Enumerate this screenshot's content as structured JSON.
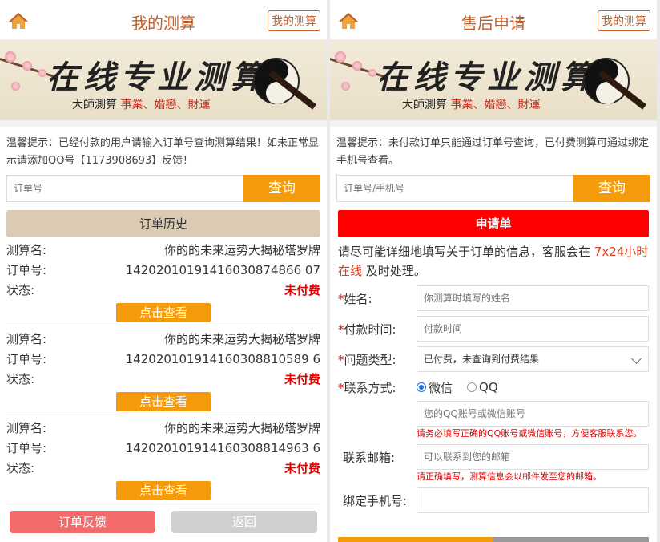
{
  "colors": {
    "accent": "#f59a0a",
    "title": "#c0612c",
    "red": "#e60000",
    "history_bar": "#dccbb4",
    "apply_bar": "#ff0000"
  },
  "banner": {
    "headline": "在线专业测算",
    "sub_prefix": "大師測算",
    "sub_items": "事業、婚戀、財運"
  },
  "left": {
    "title": "我的测算",
    "right_button": "我的测算",
    "home_icon": "home-icon",
    "tip": "温馨提示：已经付款的用户请输入订单号查询测算结果！如未正常显示请添加QQ号【1173908693】反馈！",
    "search_placeholder": "订单号",
    "search_button": "查询",
    "history_label": "订单历史",
    "field_labels": {
      "name": "测算名:",
      "order": "订单号:",
      "status": "状态:"
    },
    "view_button": "点击查看",
    "orders": [
      {
        "name": "你的的未来运势大揭秘塔罗牌",
        "order_no": "14202010191416030874866 07",
        "status": "未付费"
      },
      {
        "name": "你的的未来运势大揭秘塔罗牌",
        "order_no": "142020101914160308810589 6",
        "status": "未付费"
      },
      {
        "name": "你的的未来运势大揭秘塔罗牌",
        "order_no": "142020101914160308814963 6",
        "status": "未付费"
      }
    ],
    "bottom_buttons": [
      "订单反馈",
      "返回"
    ]
  },
  "right": {
    "title": "售后申请",
    "right_button": "我的测算",
    "tip": "温馨提示：未付款订单只能通过订单号查询，已付费测算可通过绑定手机号查看。",
    "search_placeholder": "订单号/手机号",
    "search_button": "查询",
    "apply_label": "申请单",
    "note_prefix": "请尽可能详细地填写关于订单的信息，客服会在",
    "note_red": "7x24小时在线",
    "note_suffix": "及时处理。",
    "form": {
      "name_label": "姓名:",
      "name_placeholder": "你测算时填写的姓名",
      "paytime_label": "付款时间:",
      "paytime_placeholder": "付款时间",
      "type_label": "问题类型:",
      "type_value": "已付费，未查询到付费结果",
      "contact_label": "联系方式:",
      "contact_options": [
        "微信",
        "QQ"
      ],
      "contact_placeholder": "您的QQ账号或微信账号",
      "contact_warn": "请务必填写正确的QQ账号或微信账号，方便客服联系您。",
      "email_label": "联系邮箱:",
      "email_placeholder": "可以联系到您的邮箱",
      "email_warn": "请正确填写，测算信息会以邮件发至您的邮箱。",
      "phone_label": "绑定手机号:"
    }
  }
}
